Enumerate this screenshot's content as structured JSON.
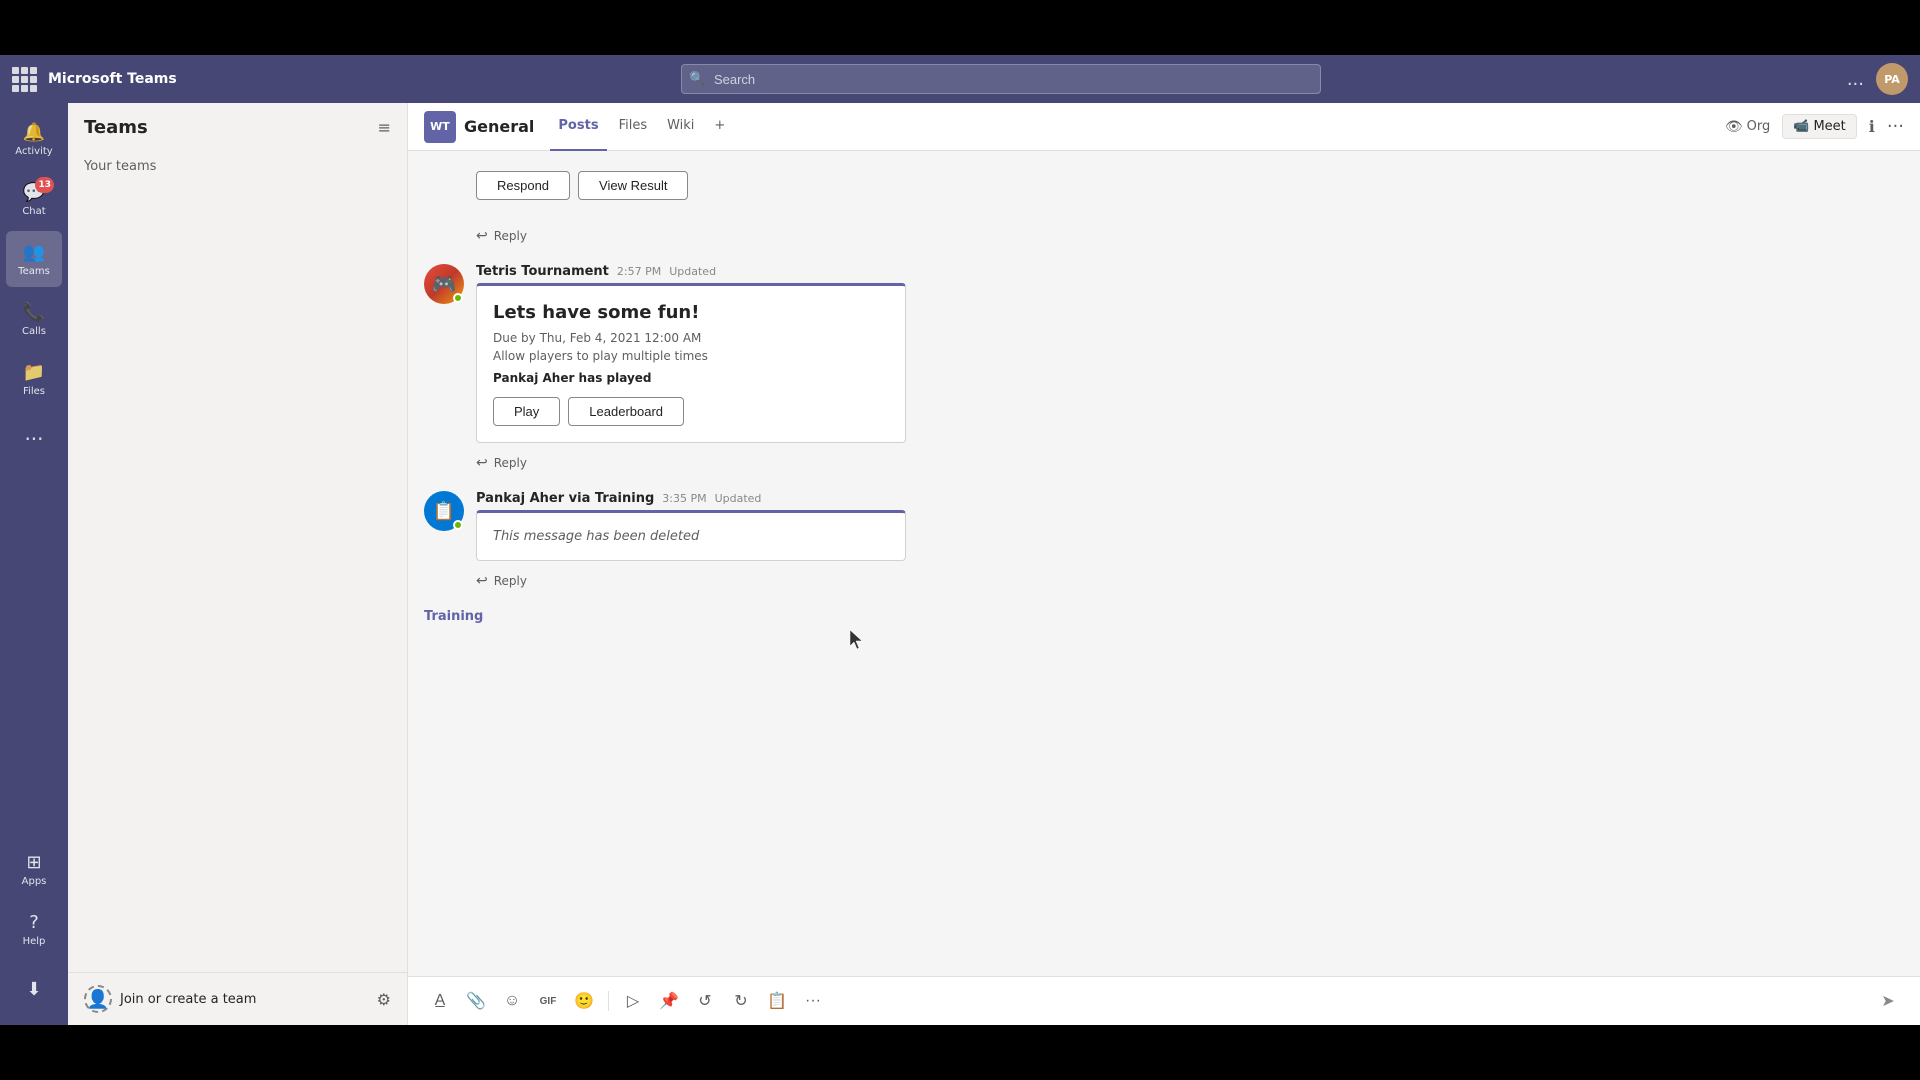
{
  "app": {
    "title": "Microsoft Teams",
    "topBarHeight": 55,
    "bottomBarHeight": 55
  },
  "titleBar": {
    "search_placeholder": "Search",
    "avatar_initials": "PA",
    "dots_label": "..."
  },
  "sidebar": {
    "items": [
      {
        "id": "activity",
        "label": "Activity",
        "icon": "🔔",
        "badge": null
      },
      {
        "id": "chat",
        "label": "Chat",
        "icon": "💬",
        "badge": "13"
      },
      {
        "id": "teams",
        "label": "Teams",
        "icon": "👥",
        "active": true,
        "badge": null
      },
      {
        "id": "calls",
        "label": "Calls",
        "icon": "📞",
        "badge": null
      },
      {
        "id": "files",
        "label": "Files",
        "icon": "📁",
        "badge": null
      }
    ],
    "more_label": "...",
    "apps_label": "Apps",
    "help_label": "Help",
    "download_label": "Download"
  },
  "teamsPanel": {
    "title": "Teams",
    "filter_icon": "≡",
    "your_teams_label": "Your teams"
  },
  "channelHeader": {
    "wt_badge": "WT",
    "channel_name": "General",
    "tabs": [
      {
        "id": "posts",
        "label": "Posts",
        "active": true
      },
      {
        "id": "files",
        "label": "Files",
        "active": false
      },
      {
        "id": "wiki",
        "label": "Wiki",
        "active": false
      }
    ],
    "add_tab_icon": "+",
    "org_label": "Org",
    "meet_label": "Meet",
    "info_icon": "ℹ",
    "more_icon": "..."
  },
  "messages": [
    {
      "id": "poll-message",
      "buttons": [
        {
          "id": "respond",
          "label": "Respond"
        },
        {
          "id": "view-result",
          "label": "View Result"
        }
      ],
      "reply_label": "Reply"
    },
    {
      "id": "tetris-message",
      "sender": "Tetris Tournament",
      "time": "2:57 PM",
      "updated": "Updated",
      "avatar_icon": "🎮",
      "card": {
        "title": "Lets have some fun!",
        "due": "Due by Thu, Feb 4, 2021 12:00 AM",
        "allow_multiple": "Allow players to play multiple times",
        "played_by": "Pankaj Aher has played",
        "buttons": [
          {
            "id": "play",
            "label": "Play"
          },
          {
            "id": "leaderboard",
            "label": "Leaderboard"
          }
        ]
      },
      "reply_label": "Reply"
    },
    {
      "id": "pankaj-message",
      "sender": "Pankaj Aher via Training",
      "time": "3:35 PM",
      "updated": "Updated",
      "avatar_icon": "📋",
      "deleted_text": "This message has been deleted",
      "reply_label": "Reply"
    }
  ],
  "trainingSection": {
    "label": "Training"
  },
  "toolbar": {
    "buttons": [
      {
        "id": "format",
        "icon": "A̲",
        "title": "Format"
      },
      {
        "id": "attach",
        "icon": "📎",
        "title": "Attach"
      },
      {
        "id": "emoji",
        "icon": "☺",
        "title": "Emoji"
      },
      {
        "id": "giphy",
        "icon": "GIF",
        "title": "Giphy"
      },
      {
        "id": "sticker",
        "icon": "🙂",
        "title": "Sticker"
      },
      {
        "id": "meet",
        "icon": "▷",
        "title": "Meet"
      },
      {
        "id": "pin",
        "icon": "📌",
        "title": "Pin"
      },
      {
        "id": "loop",
        "icon": "↺",
        "title": "Loop"
      },
      {
        "id": "loop2",
        "icon": "↻",
        "title": "Loop2"
      },
      {
        "id": "board",
        "icon": "📋",
        "title": "Board"
      },
      {
        "id": "more",
        "icon": "···",
        "title": "More"
      }
    ],
    "send_icon": "➤"
  }
}
